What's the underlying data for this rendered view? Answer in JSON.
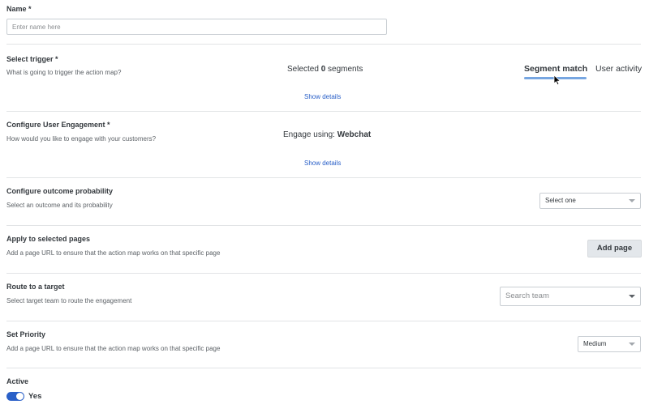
{
  "name": {
    "label": "Name *",
    "placeholder": "Enter name here"
  },
  "trigger": {
    "label": "Select trigger *",
    "description": "What is going to trigger the action map?",
    "selected_prefix": "Selected ",
    "selected_count": "0",
    "selected_suffix": " segments",
    "show_details": "Show details",
    "tabs": [
      {
        "label": "Segment match",
        "active": true
      },
      {
        "label": "User activity",
        "active": false
      }
    ]
  },
  "engagement": {
    "label": "Configure User Engagement *",
    "description": "How would you like to engage with your customers?",
    "engage_prefix": "Engage using: ",
    "engage_value": "Webchat",
    "show_details": "Show details"
  },
  "outcome": {
    "label": "Configure outcome probability",
    "description": "Select an outcome and its probability",
    "select_value": "Select one"
  },
  "pages": {
    "label": "Apply to selected pages",
    "description": "Add a page URL to ensure that the action map works on that specific page",
    "add_button": "Add page"
  },
  "route": {
    "label": "Route to a target",
    "description": "Select target team to route the engagement",
    "search_placeholder": "Search team"
  },
  "priority": {
    "label": "Set Priority",
    "description": "Add a page URL to ensure that the action map works on that specific page",
    "select_value": "Medium"
  },
  "active": {
    "label": "Active",
    "toggle_label": "Yes",
    "on": true
  },
  "colors": {
    "accent": "#2a60c8",
    "tab_underline": "#77a6e1",
    "separator": "#e2e4e6"
  }
}
